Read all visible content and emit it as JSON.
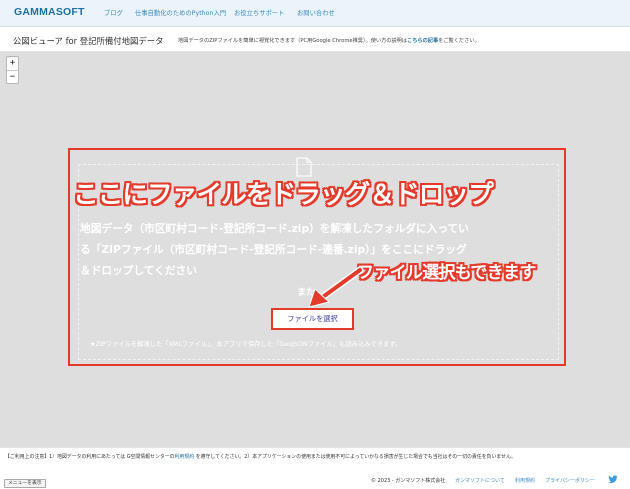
{
  "header": {
    "brand": "GAMMASOFT",
    "nav": [
      "ブログ",
      "仕事自動化のためのPython入門",
      "お役立ちサポート",
      "お問い合わせ"
    ]
  },
  "titlebar": {
    "title": "公図ビューア for 登記所備付地図データ",
    "desc_prefix": "地図データのZIPファイルを簡単に視覚化できます（PC用Google Chrome推奨）。使い方の説明は",
    "desc_link": "こちらの記事",
    "desc_suffix": "をご覧ください。"
  },
  "map": {
    "zoom_in": "+",
    "zoom_out": "−"
  },
  "dropzone": {
    "line1": "地図データ（市区町村コード-登記所コード.zip）を解凍したフォルダに入ってい",
    "line2": "る「ZIPファイル（市区町村コード-登記所コード-連番.zip）」をここにドラッグ",
    "line3": "＆ドロップしてください",
    "or_text": "また",
    "select_button": "ファイルを選択",
    "note": "★ZIPファイルを解凍した「XMLファイル」、本アプリで保存した「GeoJSONファイル」も読み込みできます。"
  },
  "annotations": {
    "drag_drop": "ここにファイルをドラッグ＆ドロップ",
    "file_select": "ファイル選択もできます",
    "color": "#e43b2c"
  },
  "footer": {
    "notice_prefix": "【ご利用上の注意】1）地図データの利用にあたっては G空間情報センターの",
    "notice_link": "利用規約",
    "notice_suffix": " を遵守してください。2）本アプリケーションの使用または使用不可によっていかなる損害が生じた場合でも当社はその一切の責任を負いません。",
    "menu_button": "メニューを表示",
    "copyright": "© 2023 - ガンマソフト株式会社",
    "links": [
      "ガンマソフトについて",
      "利用規約",
      "プライバシーポリシー"
    ],
    "social_icon": "twitter-icon"
  }
}
